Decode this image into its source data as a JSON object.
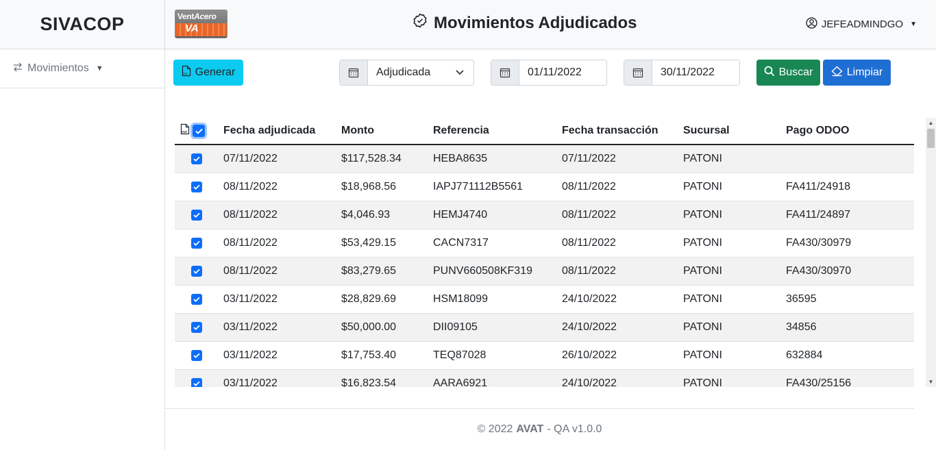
{
  "sidebar": {
    "brand": "SIVACOP",
    "items": [
      {
        "label": "Movimientos",
        "icon": "arrows-exchange-icon"
      }
    ]
  },
  "header": {
    "logo": {
      "text_top_regular": "Vent",
      "text_top_bold": "Acero",
      "text_bottom": "VA"
    },
    "title": "Movimientos Adjudicados",
    "title_icon": "check-badge-icon",
    "user": "JEFEADMINDGO"
  },
  "toolbar": {
    "generar_label": "Generar",
    "status_selected": "Adjudicada",
    "date_from": "01/11/2022",
    "date_to": "30/11/2022",
    "buscar_label": "Buscar",
    "limpiar_label": "Limpiar"
  },
  "table": {
    "columns": [
      "Fecha adjudicada",
      "Monto",
      "Referencia",
      "Fecha transacción",
      "Sucursal",
      "Pago ODOO"
    ],
    "rows": [
      {
        "checked": true,
        "fecha": "07/11/2022",
        "monto": "$117,528.34",
        "referencia": "HEBA8635",
        "fecha_trans": "07/11/2022",
        "sucursal": "PATONI",
        "pago": ""
      },
      {
        "checked": true,
        "fecha": "08/11/2022",
        "monto": "$18,968.56",
        "referencia": "IAPJ771112B5561",
        "fecha_trans": "08/11/2022",
        "sucursal": "PATONI",
        "pago": "FA411/24918"
      },
      {
        "checked": true,
        "fecha": "08/11/2022",
        "monto": "$4,046.93",
        "referencia": "HEMJ4740",
        "fecha_trans": "08/11/2022",
        "sucursal": "PATONI",
        "pago": "FA411/24897"
      },
      {
        "checked": true,
        "fecha": "08/11/2022",
        "monto": "$53,429.15",
        "referencia": "CACN7317",
        "fecha_trans": "08/11/2022",
        "sucursal": "PATONI",
        "pago": "FA430/30979"
      },
      {
        "checked": true,
        "fecha": "08/11/2022",
        "monto": "$83,279.65",
        "referencia": "PUNV660508KF319",
        "fecha_trans": "08/11/2022",
        "sucursal": "PATONI",
        "pago": "FA430/30970"
      },
      {
        "checked": true,
        "fecha": "03/11/2022",
        "monto": "$28,829.69",
        "referencia": "HSM18099",
        "fecha_trans": "24/10/2022",
        "sucursal": "PATONI",
        "pago": "36595"
      },
      {
        "checked": true,
        "fecha": "03/11/2022",
        "monto": "$50,000.00",
        "referencia": "DII09105",
        "fecha_trans": "24/10/2022",
        "sucursal": "PATONI",
        "pago": "34856"
      },
      {
        "checked": true,
        "fecha": "03/11/2022",
        "monto": "$17,753.40",
        "referencia": "TEQ87028",
        "fecha_trans": "26/10/2022",
        "sucursal": "PATONI",
        "pago": "632884"
      },
      {
        "checked": true,
        "fecha": "03/11/2022",
        "monto": "$16,823.54",
        "referencia": "AARA6921",
        "fecha_trans": "24/10/2022",
        "sucursal": "PATONI",
        "pago": "FA430/25156"
      }
    ]
  },
  "footer": {
    "copyright": "© 2022",
    "company": "AVAT",
    "version": "- QA v1.0.0"
  },
  "colors": {
    "info": "#0dcaf0",
    "success": "#198754",
    "primary": "#0d6efd",
    "limpiar": "#1f6ed4"
  }
}
